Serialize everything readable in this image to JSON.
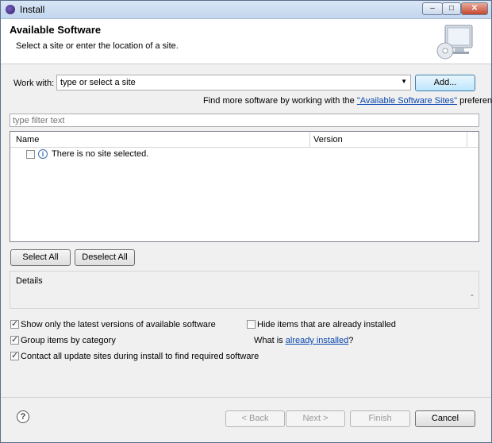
{
  "window": {
    "title": "Install",
    "controls": {
      "minimize": "–",
      "maximize": "□",
      "close": "✕"
    }
  },
  "header": {
    "title": "Available Software",
    "subtitle": "Select a site or enter the location of a site.",
    "icon": "monitor-cd-icon"
  },
  "work_with": {
    "label": "Work with:",
    "value": "type or select a site",
    "add_button": "Add..."
  },
  "find_more": {
    "prefix": "Find more software by working with the ",
    "link": "\"Available Software Sites\"",
    "suffix": " preferences."
  },
  "filter": {
    "placeholder": "type filter text"
  },
  "tree": {
    "columns": {
      "name": "Name",
      "version": "Version"
    },
    "rows": [
      {
        "label": "There is no site selected.",
        "checked": false,
        "icon": "info-icon"
      }
    ]
  },
  "selection_buttons": {
    "select_all": "Select All",
    "deselect_all": "Deselect All"
  },
  "details": {
    "label": "Details"
  },
  "options": {
    "show_latest": {
      "label": "Show only the latest versions of available software",
      "checked": true
    },
    "group_by_category": {
      "label": "Group items by category",
      "checked": true
    },
    "contact_all": {
      "label": "Contact all update sites during install to find required software",
      "checked": true
    },
    "hide_installed": {
      "label": "Hide items that are already installed",
      "checked": false
    },
    "what_is": {
      "prefix": "What is ",
      "link": "already installed",
      "suffix": "?"
    }
  },
  "footer": {
    "back": "< Back",
    "next": "Next >",
    "finish": "Finish",
    "cancel": "Cancel",
    "help_icon": "help-icon"
  }
}
